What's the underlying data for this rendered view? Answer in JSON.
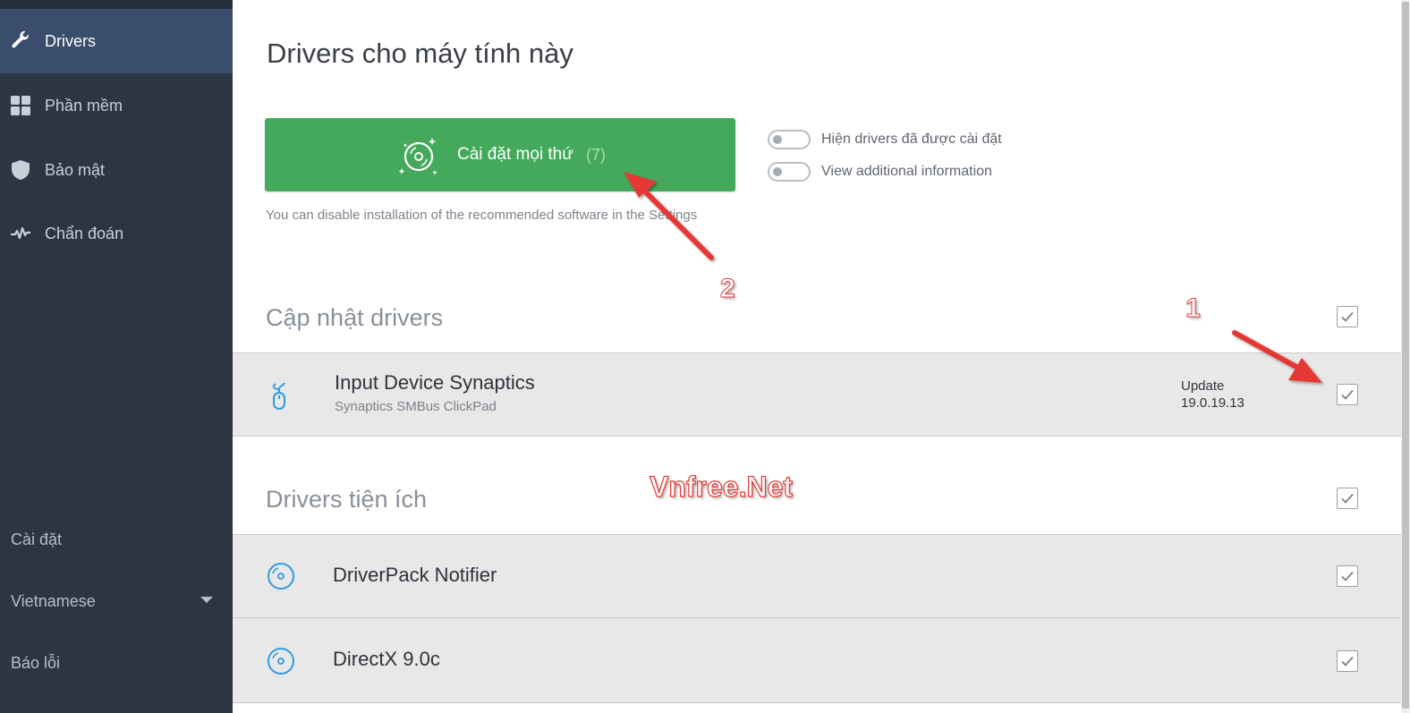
{
  "sidebar": {
    "items": [
      {
        "label": "Drivers",
        "icon": "wrench-icon",
        "active": true
      },
      {
        "label": "Phần mềm",
        "icon": "grid-icon",
        "active": false
      },
      {
        "label": "Bảo mật",
        "icon": "shield-icon",
        "active": false
      },
      {
        "label": "Chẩn đoán",
        "icon": "pulse-icon",
        "active": false
      }
    ],
    "settings_label": "Cài đặt",
    "language_label": "Vietnamese",
    "report_label": "Báo lỗi"
  },
  "main": {
    "title": "Drivers cho máy tính này",
    "install_button": {
      "label": "Cài đặt mọi thứ",
      "count": "(7)",
      "icon": "disc-sparkle-icon"
    },
    "hint": "You can disable installation of the recommended software in the Settings",
    "toggles": [
      {
        "label": "Hiện drivers đã được cài đặt",
        "on": false
      },
      {
        "label": "View additional information",
        "on": false
      }
    ],
    "sections": [
      {
        "title": "Cập nhật drivers",
        "checked": true,
        "rows": [
          {
            "name": "Input Device Synaptics",
            "sub": "Synaptics SMBus ClickPad",
            "status": "Update",
            "version": "19.0.19.13",
            "icon": "mouse-icon",
            "checked": true
          }
        ]
      },
      {
        "title": "Drivers tiện ích",
        "checked": true,
        "rows": [
          {
            "name": "DriverPack Notifier",
            "icon": "disc-icon",
            "checked": true
          },
          {
            "name": "DirectX 9.0c",
            "icon": "disc-icon",
            "checked": true
          }
        ]
      }
    ]
  },
  "annotations": {
    "label_1": "1",
    "label_2": "2",
    "watermark": "Vnfree.Net",
    "accent_color": "#e53935"
  },
  "colors": {
    "sidebar_bg": "#2b3544",
    "sidebar_active": "#3b4d6d",
    "install_green": "#45a95b",
    "row_bg": "#e8e8e8",
    "icon_blue": "#2f9be3"
  }
}
